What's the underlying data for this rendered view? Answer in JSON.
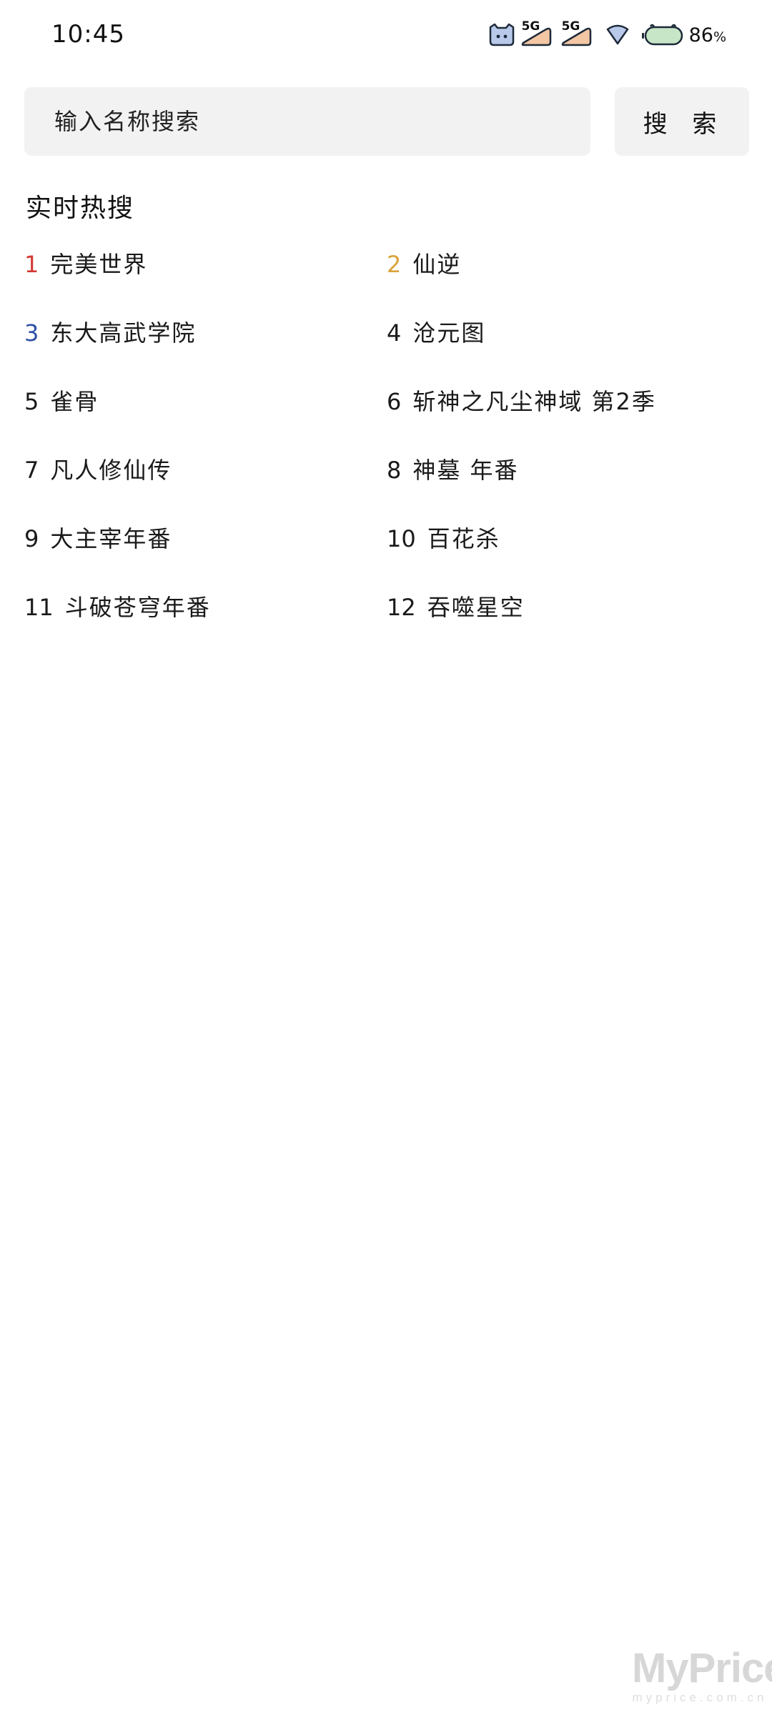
{
  "status_bar": {
    "time": "10:45",
    "network_label_1": "5G",
    "network_label_2": "5G",
    "battery": "86",
    "battery_unit": "%"
  },
  "search": {
    "placeholder": "输入名称搜索",
    "button_label": "搜 索"
  },
  "hot": {
    "title": "实时热搜",
    "rank_colors": {
      "1": "#d23a35",
      "2": "#d9a33a",
      "3": "#2d4fa6",
      "default": "#1a1a1a"
    },
    "items": [
      {
        "rank": "1",
        "name": "完美世界"
      },
      {
        "rank": "2",
        "name": "仙逆"
      },
      {
        "rank": "3",
        "name": "东大高武学院"
      },
      {
        "rank": "4",
        "name": "沧元图"
      },
      {
        "rank": "5",
        "name": "雀骨"
      },
      {
        "rank": "6",
        "name": "斩神之凡尘神域 第2季"
      },
      {
        "rank": "7",
        "name": "凡人修仙传"
      },
      {
        "rank": "8",
        "name": "神墓 年番"
      },
      {
        "rank": "9",
        "name": "大主宰年番"
      },
      {
        "rank": "10",
        "name": "百花杀"
      },
      {
        "rank": "11",
        "name": "斗破苍穹年番"
      },
      {
        "rank": "12",
        "name": "吞噬星空"
      }
    ]
  },
  "watermark": {
    "logo": "MyPrice",
    "url": "myprice.com.cn"
  }
}
